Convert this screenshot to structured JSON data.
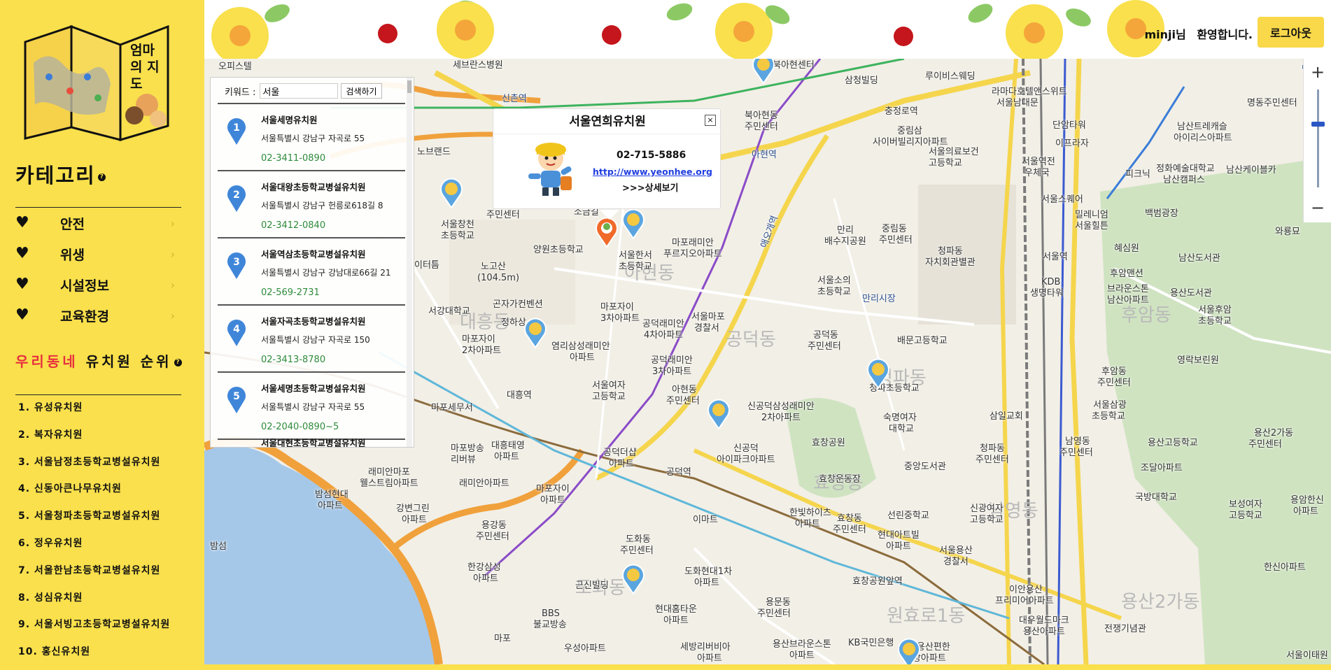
{
  "sidebar": {
    "logo_text": "엄마의 지도",
    "category_title": "카테고리",
    "help_icon": "?",
    "categories": [
      {
        "label": "안전",
        "icon": "heart-icon"
      },
      {
        "label": "위생",
        "icon": "heart-icon"
      },
      {
        "label": "시설정보",
        "icon": "heart-icon"
      },
      {
        "label": "교육환경",
        "icon": "heart-icon"
      }
    ],
    "ranking_title_red": "우리동네",
    "ranking_title_black": "유치원 순위",
    "ranking": [
      "1. 유성유치원",
      "2. 복자유치원",
      "3. 서울남정초등학교병설유치원",
      "4. 신동아큰나무유치원",
      "5. 서울청파초등학교병설유치원",
      "6. 정우유치원",
      "7. 서울한남초등학교병설유치원",
      "8. 성심유치원",
      "9. 서울서빙고초등학교병설유치원",
      "10. 홍신유치원"
    ]
  },
  "header": {
    "user": "minji님",
    "welcome": "환영합니다.",
    "logout_label": "로그아웃"
  },
  "search": {
    "keyword_label": "키워드 :",
    "keyword_value": "서울",
    "search_button": "검색하기",
    "results": [
      {
        "num": "1",
        "name": "서울세명유치원",
        "addr": "서울특별시 강남구 자곡로 55",
        "tel": "02-3411-0890"
      },
      {
        "num": "2",
        "name": "서울대왕초등학교병설유치원",
        "addr": "서울특별시 강남구 헌릉로618길 8",
        "tel": "02-3412-0840"
      },
      {
        "num": "3",
        "name": "서울역삼초등학교병설유치원",
        "addr": "서울특별시 강남구 강남대로66길 21",
        "tel": "02-569-2731"
      },
      {
        "num": "4",
        "name": "서울자곡초등학교병설유치원",
        "addr": "서울특별시 강남구 자곡로 150",
        "tel": "02-3413-8780"
      },
      {
        "num": "5",
        "name": "서울세명초등학교병설유치원",
        "addr": "서울특별시 강남구 자곡로 55",
        "tel": "02-2040-0890~5"
      },
      {
        "num": "6",
        "name": "서울대현초등학교병설유치원",
        "addr": "",
        "tel": ""
      }
    ]
  },
  "popup": {
    "title": "서울연희유치원",
    "tel": "02-715-5886",
    "url": "http://www.yeonhee.org",
    "more": ">>>상세보기",
    "close": "×"
  },
  "zoom": {
    "plus": "+",
    "minus": "−"
  },
  "map_labels": {
    "l1": "오피스텔",
    "l2": "세브란스병원",
    "l3": "북아현센터",
    "l4": "삼청빌딩",
    "l5": "루이비스웨딩",
    "l6": "라마다호텔앤스위트",
    "l7": "서울남대문",
    "l8": "명동주민센터",
    "l9": "신촌역",
    "l10": "북아현동",
    "l11": "주민센터",
    "l12": "충정로역",
    "l13": "중림삼",
    "l14": "사이버빌리지아파트",
    "l15": "단암타워",
    "l16": "이프라자",
    "l17": "남산트레캐슬",
    "l18": "아이리스아파트",
    "l19": "노브랜드",
    "l20": "아현역",
    "l21": "서울의료보건",
    "l22": "고등학교",
    "l23": "서울역전",
    "l24": "우체국",
    "l25": "피크닉",
    "l26": "정화예술대학교",
    "l27": "남산캠퍼스",
    "l28": "남산케이블카",
    "l29": "서울창천",
    "l30": "초등학교",
    "l31": "주민센터",
    "l32": "애오개역",
    "l33": "서울스퀘어",
    "l34": "밀레니엄",
    "l35": "서울힐튼",
    "l36": "백범광장",
    "l37": "와룡묘",
    "l38": "노고산",
    "l39": "(104.5m)",
    "l40": "양원초등학교",
    "l41": "서울한서",
    "l42": "초등학교",
    "l43": "마포래미안",
    "l44": "푸르지오아파트",
    "l45": "아현동",
    "l46": "만리",
    "l47": "배수지공원",
    "l48": "중림동",
    "l49": "주민센터",
    "l50": "청파동",
    "l51": "자치회관별관",
    "l52": "서울역",
    "l53": "혜심원",
    "l54": "남산도서관",
    "l55": "이터틈",
    "l56": "서강대학교",
    "l57": "곤자가컨벤션",
    "l58": "정하상",
    "l59": "마포자이",
    "l60": "3차아파트",
    "l61": "서울마포",
    "l62": "경찰서",
    "l63": "서울소의",
    "l64": "초등학교",
    "l65": "KDB",
    "l66": "생명타워",
    "l67": "후암맨션",
    "l68": "브라운스톤",
    "l69": "남산아파트",
    "l70": "용산도서관",
    "l71": "서울후암",
    "l72": "초등학교",
    "l73": "후암동",
    "l74": "마포자이",
    "l75": "2차아파트",
    "l76": "염리삼성래미안",
    "l77": "아파트",
    "l78": "공덕래미안",
    "l79": "4차아파트",
    "l80": "공덕동",
    "l81": "주민센터",
    "l82": "만리시장",
    "l83": "배문고등학교",
    "l84": "후암동",
    "l85": "주민센터",
    "l86": "영락보린원",
    "l87": "대흥역",
    "l88": "공덕래미안",
    "l89": "3차아파트",
    "l90": "청파초등학교",
    "l91": "청파동",
    "l92": "서울여자",
    "l93": "고등학교",
    "l94": "아현동",
    "l95": "주민센터",
    "l96": "신공덕삼성래미안",
    "l97": "2차아파트",
    "l98": "숙명여자",
    "l99": "대학교",
    "l100": "삼일교회",
    "l101": "서울삼광",
    "l102": "초등학교",
    "l103": "마포세무서",
    "l104": "마포방송",
    "l105": "리버뷰",
    "l106": "대흥태영",
    "l107": "아파트",
    "l108": "공덕더샵",
    "l109": "아파트",
    "l110": "신공덕",
    "l111": "아이파크아파트",
    "l112": "효창공원",
    "l113": "청파동",
    "l114": "주민센터",
    "l115": "남영동",
    "l116": "주민센터",
    "l117": "용산고등학교",
    "l118": "용산2가동",
    "l119": "주민센터",
    "l120": "래미안마포",
    "l121": "웰스트림아파트",
    "l122": "래미안아파트",
    "l123": "마포자이",
    "l124": "아파트",
    "l125": "공덕역",
    "l126": "효창운동장",
    "l127": "중앙도서관",
    "l128": "조달아파트",
    "l129": "밤섬현대",
    "l130": "아파트",
    "l131": "강변그린",
    "l132": "아파트",
    "l133": "용강동",
    "l134": "주민센터",
    "l135": "이마트",
    "l136": "한빛하이츠",
    "l137": "아파트",
    "l138": "효창동",
    "l139": "주민센터",
    "l140": "선린중학교",
    "l141": "신광여자",
    "l142": "고등학교",
    "l143": "국방대학교",
    "l144": "보성여자",
    "l145": "고등학교",
    "l146": "용암한신",
    "l147": "아파트",
    "l148": "밤섬",
    "l149": "현대아트빌",
    "l150": "아파트",
    "l151": "서울용산",
    "l152": "경찰서",
    "l153": "도화동",
    "l154": "주민센터",
    "l155": "한강삼성",
    "l156": "아파트",
    "l157": "근신빌딩",
    "l158": "도화현대1차",
    "l159": "아파트",
    "l160": "효창공원앞역",
    "l161": "이안용산",
    "l162": "프리미어아파트",
    "l163": "한신아파트",
    "l164": "BBS",
    "l165": "불교방송",
    "l166": "현대홈타운",
    "l167": "아파트",
    "l168": "용문동",
    "l169": "주민센터",
    "l170": "대우월드마크",
    "l171": "용산아파트",
    "l172": "전쟁기념관",
    "l173": "우성아파트",
    "l174": "세방리버비아",
    "l175": "아파트",
    "l176": "용산브라운스톤",
    "l177": "아파트",
    "l178": "KB국민은행",
    "l179": "서울용산편한",
    "l180": "세상아파트",
    "l181": "서울이태원",
    "l182": "마포",
    "l183": "소금길",
    "l184": "명동",
    "d1": "대흥동",
    "d2": "아현동",
    "d3": "공덕동",
    "d4": "청파동",
    "d5": "효창동",
    "d6": "남영동",
    "d7": "도화동",
    "d8": "용산2가동",
    "d9": "후암동",
    "d10": "원효로1동"
  },
  "colors": {
    "sidebar": "#f9e04c",
    "accent_red": "#e8303f",
    "tel_green": "#2e8b3a",
    "link_blue": "#1f3ddf"
  }
}
